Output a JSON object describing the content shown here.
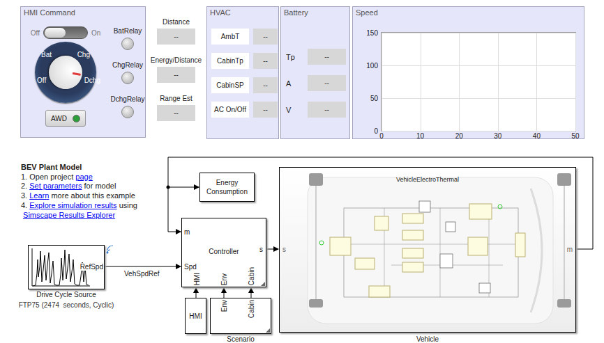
{
  "hmi_command": {
    "title": "HMI Command",
    "switch": {
      "off_label": "Off",
      "on_label": "On",
      "on": false
    },
    "knob": {
      "positions": [
        {
          "label": "Bat",
          "selected": false
        },
        {
          "label": "Chg",
          "selected": false
        },
        {
          "label": "Off",
          "selected": false
        },
        {
          "label": "Dchg",
          "selected": true
        }
      ]
    },
    "lamps": [
      {
        "label": "BatRelay",
        "on": false
      },
      {
        "label": "ChgRelay",
        "on": false
      },
      {
        "label": "DchgRelay",
        "on": false
      }
    ],
    "awd_button": {
      "label": "AWD",
      "on": true,
      "color": "#2e9e3a"
    }
  },
  "displays": [
    {
      "label": "Distance",
      "value": "--"
    },
    {
      "label": "Energy/Distance",
      "value": "--"
    },
    {
      "label": "Range Est",
      "value": "--"
    }
  ],
  "hvac": {
    "title": "HVAC",
    "rows": [
      {
        "label": "AmbT",
        "value": "--"
      },
      {
        "label": "CabinTp",
        "value": "--"
      },
      {
        "label": "CabinSP",
        "value": "--"
      },
      {
        "label": "AC On/Off",
        "value": "--"
      }
    ]
  },
  "battery": {
    "title": "Battery",
    "rows": [
      {
        "label": "Tp",
        "value": "--"
      },
      {
        "label": "A",
        "value": "--"
      },
      {
        "label": "V",
        "value": "--"
      }
    ]
  },
  "speed_chart": {
    "title": "Speed",
    "y_ticks": [
      "0",
      "50",
      "100",
      "150"
    ],
    "x_ticks": [
      "0",
      "10",
      "20",
      "30",
      "40",
      "50"
    ],
    "series": []
  },
  "model": {
    "title": "BEV Plant Model",
    "lines": [
      [
        {
          "text": "1. Open project ",
          "link": false
        },
        {
          "text": "page",
          "link": true
        }
      ],
      [
        {
          "text": "2. ",
          "link": false
        },
        {
          "text": "Set parameters",
          "link": true
        },
        {
          "text": " for model",
          "link": false
        }
      ],
      [
        {
          "text": "3. ",
          "link": false
        },
        {
          "text": "Learn",
          "link": true
        },
        {
          "text": " more about this example",
          "link": false
        }
      ],
      [
        {
          "text": "4. ",
          "link": false
        },
        {
          "text": "Explore simulation results",
          "link": true
        },
        {
          "text": " using",
          "link": false
        }
      ],
      [
        {
          "text": " ",
          "link": false
        },
        {
          "text": "Simscape Results Explorer",
          "link": true
        }
      ]
    ]
  },
  "blocks": {
    "drive_cycle": {
      "port": "RefSpd",
      "name": "Drive Cycle Source",
      "caption": "FTP75 (2474  seconds, Cyclic)"
    },
    "signal": "VehSpdRef",
    "controller": {
      "name": "Controller",
      "inputs": [
        "m",
        "Spd"
      ],
      "bottom_inputs": [
        "HMI",
        "Env",
        "Cabin"
      ],
      "output": "s"
    },
    "energy": {
      "name": "Energy Consumption"
    },
    "hmi": {
      "name": "HMI"
    },
    "scenario": {
      "name": "Scenario",
      "outputs": [
        "Env",
        "Cabin"
      ]
    },
    "vehicle": {
      "name": "Vehicle",
      "title": "VehicleElectroThermal",
      "input": "s",
      "output": "m"
    }
  }
}
